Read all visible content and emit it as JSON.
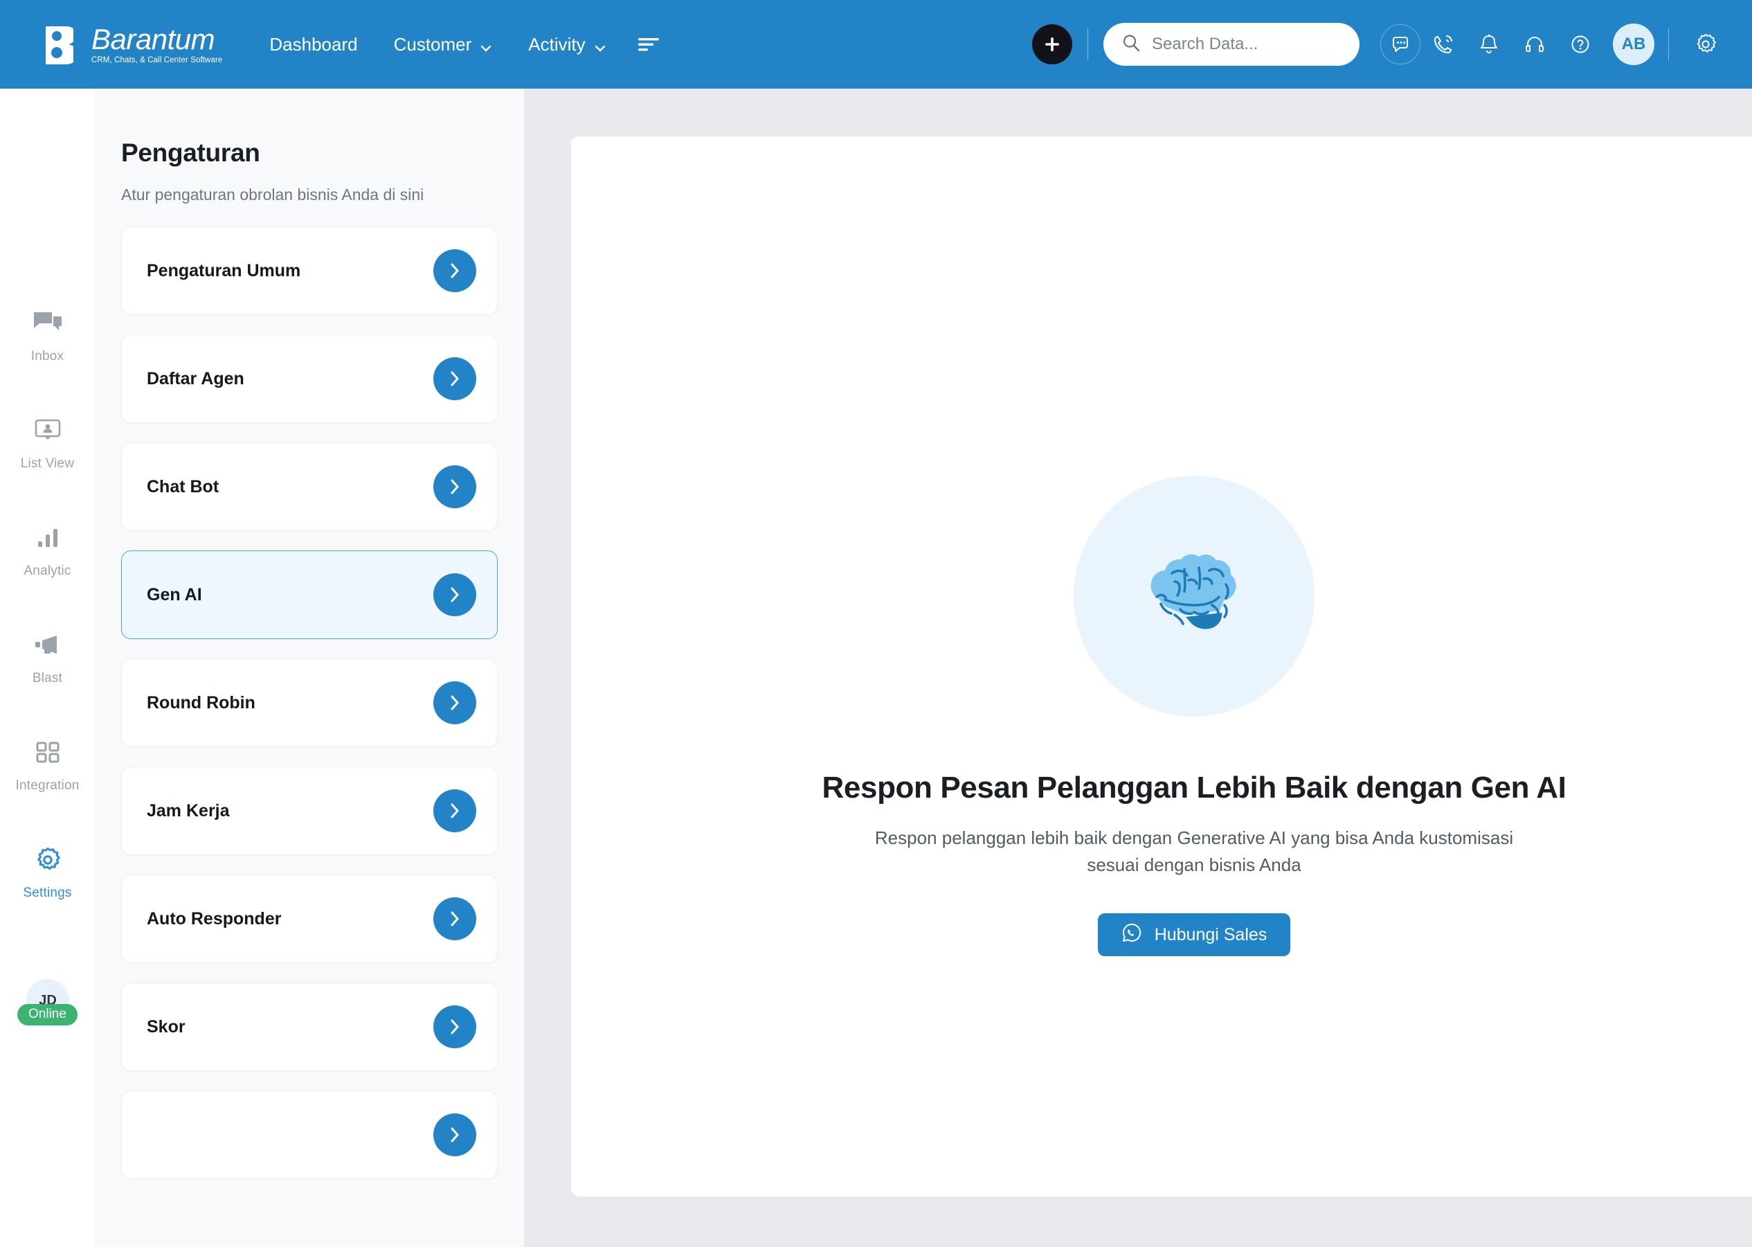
{
  "brand": {
    "name": "Barantum",
    "tagline": "CRM, Chats, & Call Center Software"
  },
  "topnav": {
    "links": [
      {
        "label": "Dashboard",
        "has_chevron": false
      },
      {
        "label": "Customer",
        "has_chevron": true
      },
      {
        "label": "Activity",
        "has_chevron": true
      }
    ],
    "menu_icon": "hamburger-lines-icon"
  },
  "topbar_actions": {
    "add_label": "+",
    "search": {
      "value": "",
      "placeholder": "Search Data..."
    },
    "icons": [
      "chat-bubble-icon",
      "phone-call-icon",
      "bell-icon",
      "headset-icon",
      "question-circle-icon"
    ],
    "avatar_initials": "AB",
    "settings_icon": "gear-icon"
  },
  "rail": {
    "items": [
      {
        "label": "Inbox",
        "icon": "chat-icon",
        "active": false
      },
      {
        "label": "List View",
        "icon": "contact-card-icon",
        "active": false
      },
      {
        "label": "Analytic",
        "icon": "bar-chart-icon",
        "active": false
      },
      {
        "label": "Blast",
        "icon": "megaphone-icon",
        "active": false
      },
      {
        "label": "Integration",
        "icon": "grid-squares-icon",
        "active": false
      },
      {
        "label": "Settings",
        "icon": "gear-icon",
        "active": true
      }
    ],
    "user": {
      "initials": "JD",
      "status": "Online"
    }
  },
  "settings_panel": {
    "title": "Pengaturan",
    "subtitle": "Atur pengaturan obrolan bisnis Anda di sini",
    "items": [
      {
        "label": "Pengaturan Umum",
        "selected": false
      },
      {
        "label": "Daftar Agen",
        "selected": false
      },
      {
        "label": "Chat Bot",
        "selected": false
      },
      {
        "label": "Gen AI",
        "selected": true
      },
      {
        "label": "Round Robin",
        "selected": false
      },
      {
        "label": "Jam Kerja",
        "selected": false
      },
      {
        "label": "Auto Responder",
        "selected": false
      },
      {
        "label": "Skor",
        "selected": false
      },
      {
        "label": "",
        "selected": false
      }
    ]
  },
  "main": {
    "illustration": "brain-icon",
    "title": "Respon Pesan Pelanggan Lebih Baik dengan Gen AI",
    "description": "Respon pelanggan lebih baik dengan Generative AI yang bisa Anda kustomisasi sesuai dengan bisnis Anda",
    "cta": {
      "label": "Hubungi Sales",
      "icon": "whatsapp-icon"
    }
  },
  "colors": {
    "brand_blue": "#2284c6",
    "selected_bg": "#eef7fe",
    "selected_border": "#4fa3d8",
    "page_bg": "#e9eaee",
    "panel_bg": "#f8f9fb",
    "online_green": "#3cb371",
    "brain_light": "#7cc4f0",
    "brain_dark": "#1d7cb5"
  }
}
